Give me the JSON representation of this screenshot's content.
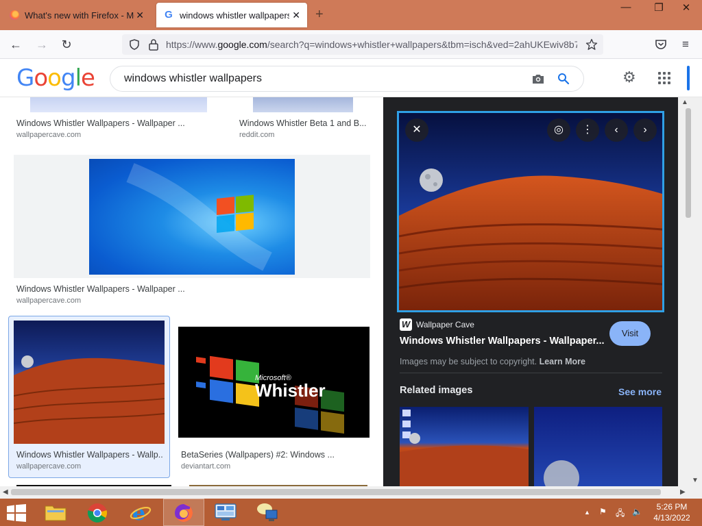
{
  "browser": {
    "tabs": [
      {
        "title": "What's new with Firefox - More",
        "active": false
      },
      {
        "title": "windows whistler wallpapers - G",
        "active": true
      }
    ],
    "url_prefix": "https://www.",
    "url_domain": "google.com",
    "url_rest": "/search?q=windows+whistler+wallpapers&tbm=isch&ved=2ahUKEwiv8b7"
  },
  "google": {
    "logo": [
      "G",
      "o",
      "o",
      "g",
      "l",
      "e"
    ],
    "logo_colors": [
      "#4285f4",
      "#ea4335",
      "#fbbc05",
      "#4285f4",
      "#34a853",
      "#ea4335"
    ],
    "search_query": "windows whistler wallpapers"
  },
  "results": [
    {
      "title": "Windows Whistler Wallpapers - Wallpaper ...",
      "source": "wallpapercave.com"
    },
    {
      "title": "Windows Whistler Beta 1 and B...",
      "source": "reddit.com"
    },
    {
      "title": "Windows Whistler Wallpapers - Wallpaper ...",
      "source": "wallpapercave.com"
    },
    {
      "title": "Windows Whistler Wallpapers - Wallp...",
      "source": "wallpapercave.com"
    },
    {
      "title": "BetaSeries (Wallpapers) #2: Windows ...",
      "source": "deviantart.com"
    }
  ],
  "whistler_logo": {
    "brand": "Microsoft®",
    "name": "Whistler"
  },
  "preview": {
    "source_name": "Wallpaper Cave",
    "source_icon_letter": "W",
    "title": "Windows Whistler Wallpapers - Wallpaper...",
    "visit_label": "Visit",
    "copyright_text": "Images may be subject to copyright.",
    "learn_more": "Learn More",
    "related_label": "Related images",
    "see_more": "See more"
  },
  "taskbar": {
    "time": "5:26 PM",
    "date": "4/13/2022"
  },
  "colors": {
    "accent_blue": "#1a73e8",
    "selected_border": "#2fa0e6",
    "taskbar": "#b55d34",
    "tabbar": "#cf7a58"
  }
}
